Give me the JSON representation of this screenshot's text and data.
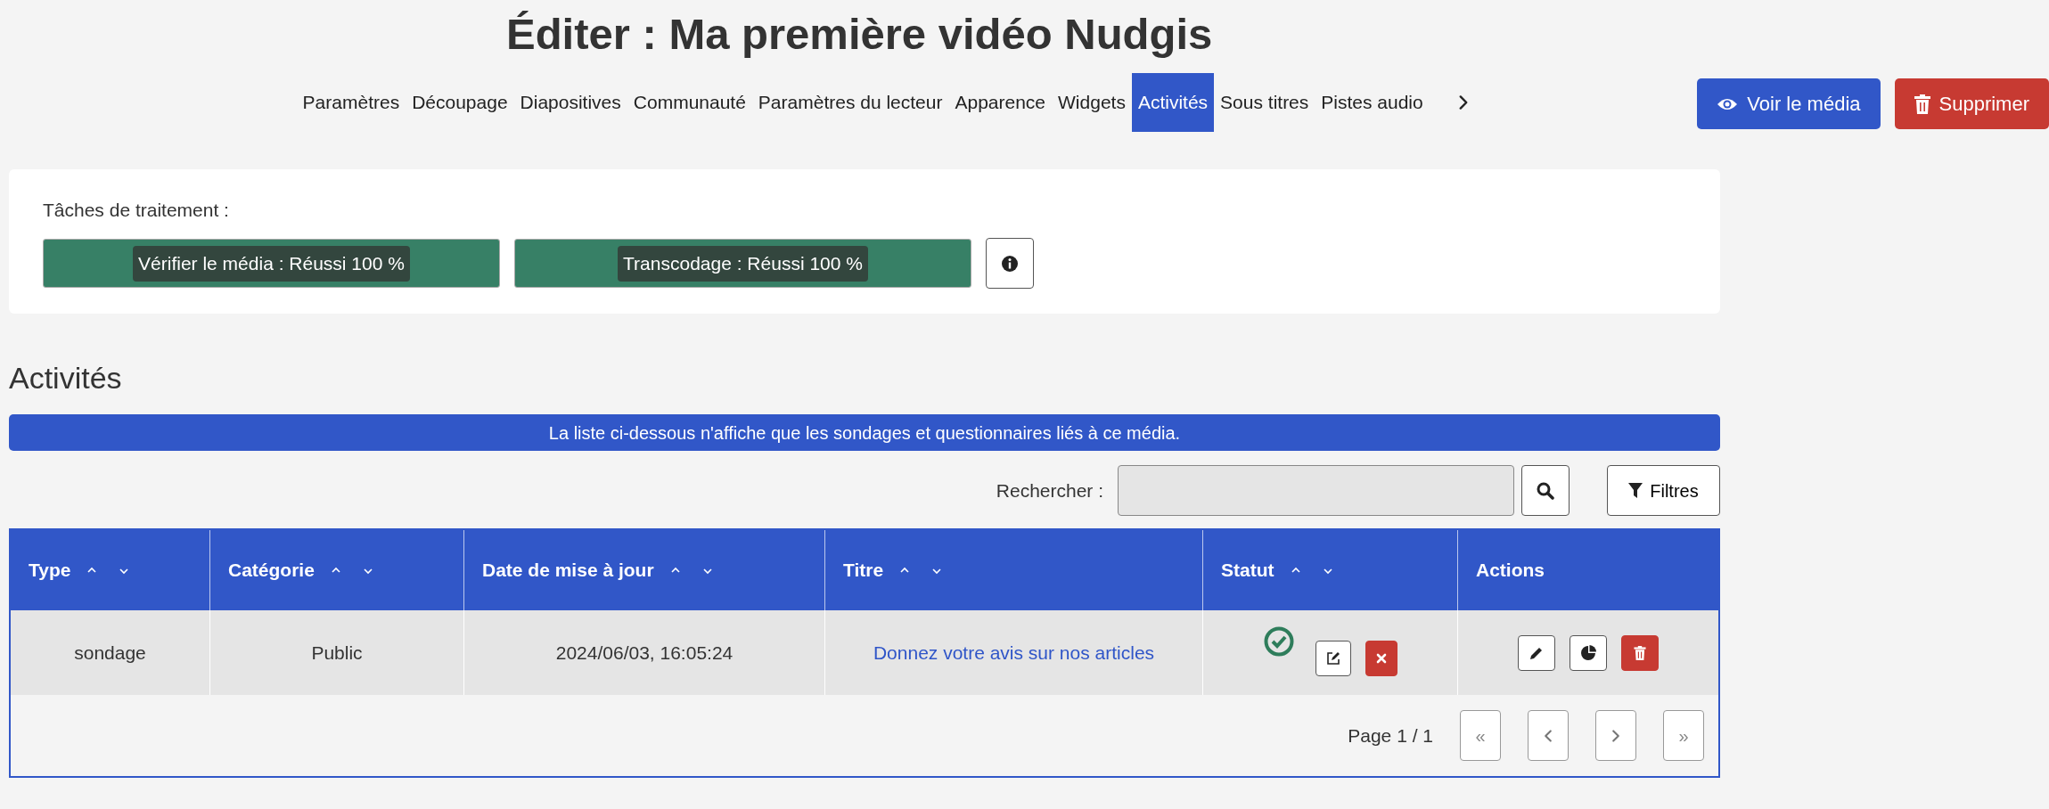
{
  "page_title": "Éditer : Ma première vidéo Nudgis",
  "tabs": [
    {
      "label": "Paramètres",
      "selected": false
    },
    {
      "label": "Découpage",
      "selected": false
    },
    {
      "label": "Diapositives",
      "selected": false
    },
    {
      "label": "Communauté",
      "selected": false
    },
    {
      "label": "Paramètres du lecteur",
      "selected": false
    },
    {
      "label": "Apparence",
      "selected": false
    },
    {
      "label": "Widgets",
      "selected": false
    },
    {
      "label": "Activités",
      "selected": true
    },
    {
      "label": "Sous titres",
      "selected": false
    },
    {
      "label": "Pistes audio",
      "selected": false
    }
  ],
  "header_buttons": [
    {
      "label": "Voir le média",
      "kind": "view"
    },
    {
      "label": "Supprimer",
      "kind": "delete"
    }
  ],
  "processing": {
    "label": "Tâches de traitement :",
    "tasks": [
      {
        "label": "Vérifier le média : Réussi 100 %",
        "level": 1
      },
      {
        "label": "Transcodage : Réussi 100 %",
        "level": 1
      }
    ]
  },
  "section_title": "Activités",
  "notice": "La liste ci-dessous n'affiche que les sondages et questionnaires liés à ce média.",
  "search": {
    "label": "Rechercher :"
  },
  "filters_button": "Filtres",
  "table": {
    "columns": [
      "Type",
      "Catégorie",
      "Date de mise à jour",
      "Titre",
      "Statut",
      "Actions"
    ],
    "rows": [
      {
        "type": "sondage",
        "category": "Public",
        "updated": "2024/06/03, 16:05:24",
        "title": "Donnez votre avis sur nos articles",
        "validated": true
      }
    ]
  },
  "pagination": {
    "page": "Page 1 / 1",
    "first": "«",
    "last": "»"
  }
}
